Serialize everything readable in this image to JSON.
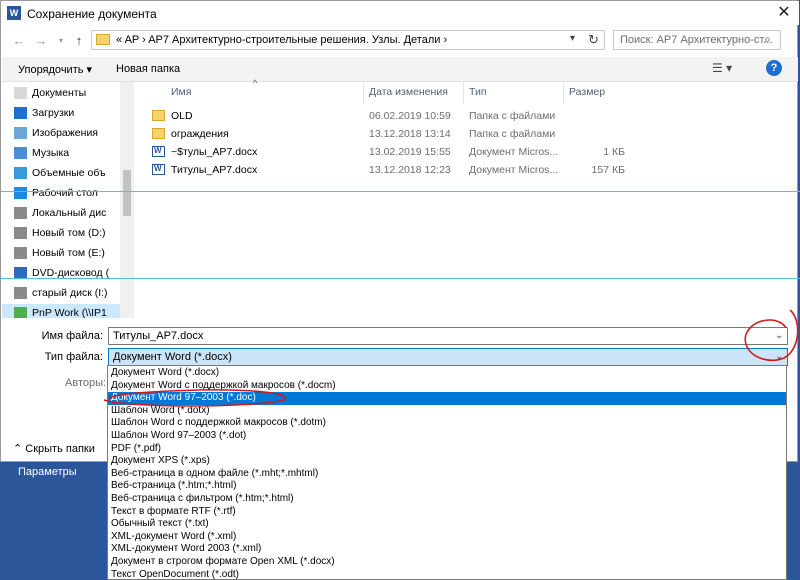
{
  "window": {
    "title": "Сохранение документа",
    "close": "✕"
  },
  "address": {
    "path": "«  AP  ›  AP7 Архитектурно-строительные решения. Узлы. Детали  ›",
    "search_placeholder": "Поиск: AP7 Архитектурно-ст..."
  },
  "toolbar": {
    "organize": "Упорядочить ▾",
    "new_folder": "Новая папка"
  },
  "nav": {
    "items": [
      {
        "label": "Документы",
        "icon": "documents-icon"
      },
      {
        "label": "Загрузки",
        "icon": "downloads-icon"
      },
      {
        "label": "Изображения",
        "icon": "pictures-icon"
      },
      {
        "label": "Музыка",
        "icon": "music-icon"
      },
      {
        "label": "Объемные объ",
        "icon": "3d-objects-icon"
      },
      {
        "label": "Рабочий стол",
        "icon": "desktop-icon"
      },
      {
        "label": "Локальный дис",
        "icon": "drive-icon"
      },
      {
        "label": "Новый том (D:)",
        "icon": "drive-icon"
      },
      {
        "label": "Новый том (E:)",
        "icon": "drive-icon"
      },
      {
        "label": "DVD-дисковод (",
        "icon": "dvd-icon"
      },
      {
        "label": "старый диск (I:)",
        "icon": "drive-icon"
      },
      {
        "label": "PnP Work (\\\\IP1",
        "icon": "network-drive-icon"
      }
    ]
  },
  "filelist": {
    "columns": [
      "Имя",
      "Дата изменения",
      "Тип",
      "Размер"
    ],
    "rows": [
      {
        "name": "OLD",
        "date": "06.02.2019 10:59",
        "type": "Папка с файлами",
        "size": "",
        "kind": "folder"
      },
      {
        "name": "ограждения",
        "date": "13.12.2018 13:14",
        "type": "Папка с файлами",
        "size": "",
        "kind": "folder"
      },
      {
        "name": "~$тулы_AP7.docx",
        "date": "13.02.2019 15:55",
        "type": "Документ Micros...",
        "size": "1 КБ",
        "kind": "doc"
      },
      {
        "name": "Титулы_AP7.docx",
        "date": "13.12.2018 12:23",
        "type": "Документ Micros...",
        "size": "157 КБ",
        "kind": "doc"
      }
    ]
  },
  "form": {
    "filename_label": "Имя файла:",
    "filename_value": "Титулы_AP7.docx",
    "filetype_label": "Тип файла:",
    "filetype_value": "Документ Word (*.docx)",
    "authors_label": "Авторы:",
    "hide_folders": "Скрыть папки"
  },
  "filetype_options": [
    "Документ Word (*.docx)",
    "Документ Word с поддержкой макросов (*.docm)",
    "Документ Word 97–2003 (*.doc)",
    "Шаблон Word (*.dotx)",
    "Шаблон Word с поддержкой макросов (*.dotm)",
    "Шаблон Word 97–2003 (*.dot)",
    "PDF (*.pdf)",
    "Документ XPS (*.xps)",
    "Веб-страница в одном файле (*.mht;*.mhtml)",
    "Веб-страница (*.htm;*.html)",
    "Веб-страница с фильтром (*.htm;*.html)",
    "Текст в формате RTF (*.rtf)",
    "Обычный текст (*.txt)",
    "XML-документ Word (*.xml)",
    "XML-документ Word 2003 (*.xml)",
    "Документ в строгом формате Open XML (*.docx)",
    "Текст OpenDocument (*.odt)"
  ],
  "selected_option_index": 2,
  "background": {
    "parameters": "Параметры"
  },
  "colors": {
    "accent": "#0078d7",
    "word_blue": "#2b579a",
    "annotation_red": "#d21a1a"
  }
}
